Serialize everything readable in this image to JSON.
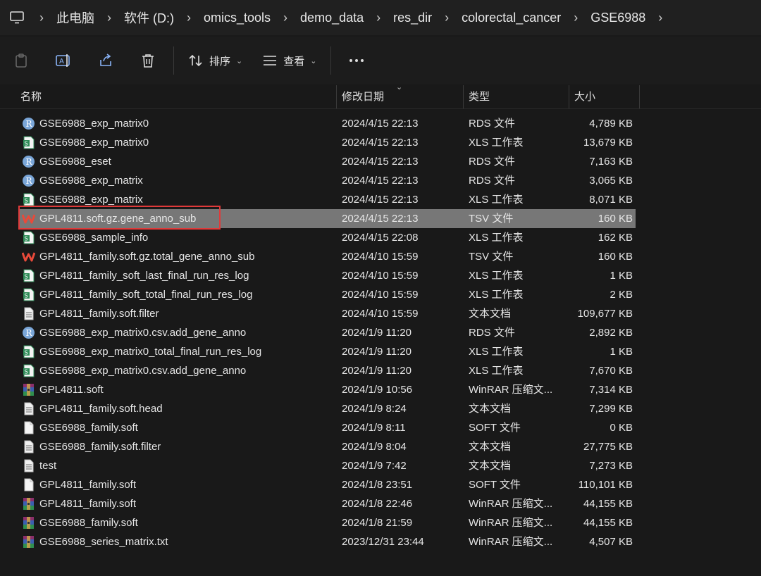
{
  "breadcrumb": [
    "此电脑",
    "软件 (D:)",
    "omics_tools",
    "demo_data",
    "res_dir",
    "colorectal_cancer",
    "GSE6988"
  ],
  "toolbar": {
    "sort_label": "排序",
    "view_label": "查看"
  },
  "columns": {
    "name": "名称",
    "modified": "修改日期",
    "type": "类型",
    "size": "大小"
  },
  "colors": {
    "selected_row": "#777777",
    "highlight_box": "#e03a3a"
  },
  "files": [
    {
      "name": "GSE6988_exp_matrix0",
      "date": "2024/4/15 22:13",
      "type": "RDS 文件",
      "size": "4,789 KB",
      "icon": "r-icon"
    },
    {
      "name": "GSE6988_exp_matrix0",
      "date": "2024/4/15 22:13",
      "type": "XLS 工作表",
      "size": "13,679 KB",
      "icon": "xls-icon"
    },
    {
      "name": "GSE6988_eset",
      "date": "2024/4/15 22:13",
      "type": "RDS 文件",
      "size": "7,163 KB",
      "icon": "r-icon"
    },
    {
      "name": "GSE6988_exp_matrix",
      "date": "2024/4/15 22:13",
      "type": "RDS 文件",
      "size": "3,065 KB",
      "icon": "r-icon"
    },
    {
      "name": "GSE6988_exp_matrix",
      "date": "2024/4/15 22:13",
      "type": "XLS 工作表",
      "size": "8,071 KB",
      "icon": "xls-icon"
    },
    {
      "name": "GPL4811.soft.gz.gene_anno_sub",
      "date": "2024/4/15 22:13",
      "type": "TSV 文件",
      "size": "160 KB",
      "icon": "wps-icon",
      "selected": true
    },
    {
      "name": "GSE6988_sample_info",
      "date": "2024/4/15 22:08",
      "type": "XLS 工作表",
      "size": "162 KB",
      "icon": "xls-icon"
    },
    {
      "name": "GPL4811_family.soft.gz.total_gene_anno_sub",
      "date": "2024/4/10 15:59",
      "type": "TSV 文件",
      "size": "160 KB",
      "icon": "wps-icon"
    },
    {
      "name": "GPL4811_family_soft_last_final_run_res_log",
      "date": "2024/4/10 15:59",
      "type": "XLS 工作表",
      "size": "1 KB",
      "icon": "xls-icon"
    },
    {
      "name": "GPL4811_family_soft_total_final_run_res_log",
      "date": "2024/4/10 15:59",
      "type": "XLS 工作表",
      "size": "2 KB",
      "icon": "xls-icon"
    },
    {
      "name": "GPL4811_family.soft.filter",
      "date": "2024/4/10 15:59",
      "type": "文本文档",
      "size": "109,677 KB",
      "icon": "text-file-icon"
    },
    {
      "name": "GSE6988_exp_matrix0.csv.add_gene_anno",
      "date": "2024/1/9 11:20",
      "type": "RDS 文件",
      "size": "2,892 KB",
      "icon": "r-icon"
    },
    {
      "name": "GSE6988_exp_matrix0_total_final_run_res_log",
      "date": "2024/1/9 11:20",
      "type": "XLS 工作表",
      "size": "1 KB",
      "icon": "xls-icon"
    },
    {
      "name": "GSE6988_exp_matrix0.csv.add_gene_anno",
      "date": "2024/1/9 11:20",
      "type": "XLS 工作表",
      "size": "7,670 KB",
      "icon": "xls-icon"
    },
    {
      "name": "GPL4811.soft",
      "date": "2024/1/9 10:56",
      "type": "WinRAR 压缩文...",
      "size": "7,314 KB",
      "icon": "winrar-icon"
    },
    {
      "name": "GPL4811_family.soft.head",
      "date": "2024/1/9 8:24",
      "type": "文本文档",
      "size": "7,299 KB",
      "icon": "text-file-icon"
    },
    {
      "name": "GSE6988_family.soft",
      "date": "2024/1/9 8:11",
      "type": "SOFT 文件",
      "size": "0 KB",
      "icon": "blank-file-icon"
    },
    {
      "name": "GSE6988_family.soft.filter",
      "date": "2024/1/9 8:04",
      "type": "文本文档",
      "size": "27,775 KB",
      "icon": "text-file-icon"
    },
    {
      "name": "test",
      "date": "2024/1/9 7:42",
      "type": "文本文档",
      "size": "7,273 KB",
      "icon": "text-file-icon"
    },
    {
      "name": "GPL4811_family.soft",
      "date": "2024/1/8 23:51",
      "type": "SOFT 文件",
      "size": "110,101 KB",
      "icon": "blank-file-icon"
    },
    {
      "name": "GPL4811_family.soft",
      "date": "2024/1/8 22:46",
      "type": "WinRAR 压缩文...",
      "size": "44,155 KB",
      "icon": "winrar-icon"
    },
    {
      "name": "GSE6988_family.soft",
      "date": "2024/1/8 21:59",
      "type": "WinRAR 压缩文...",
      "size": "44,155 KB",
      "icon": "winrar-icon"
    },
    {
      "name": "GSE6988_series_matrix.txt",
      "date": "2023/12/31 23:44",
      "type": "WinRAR 压缩文...",
      "size": "4,507 KB",
      "icon": "winrar-icon"
    }
  ]
}
